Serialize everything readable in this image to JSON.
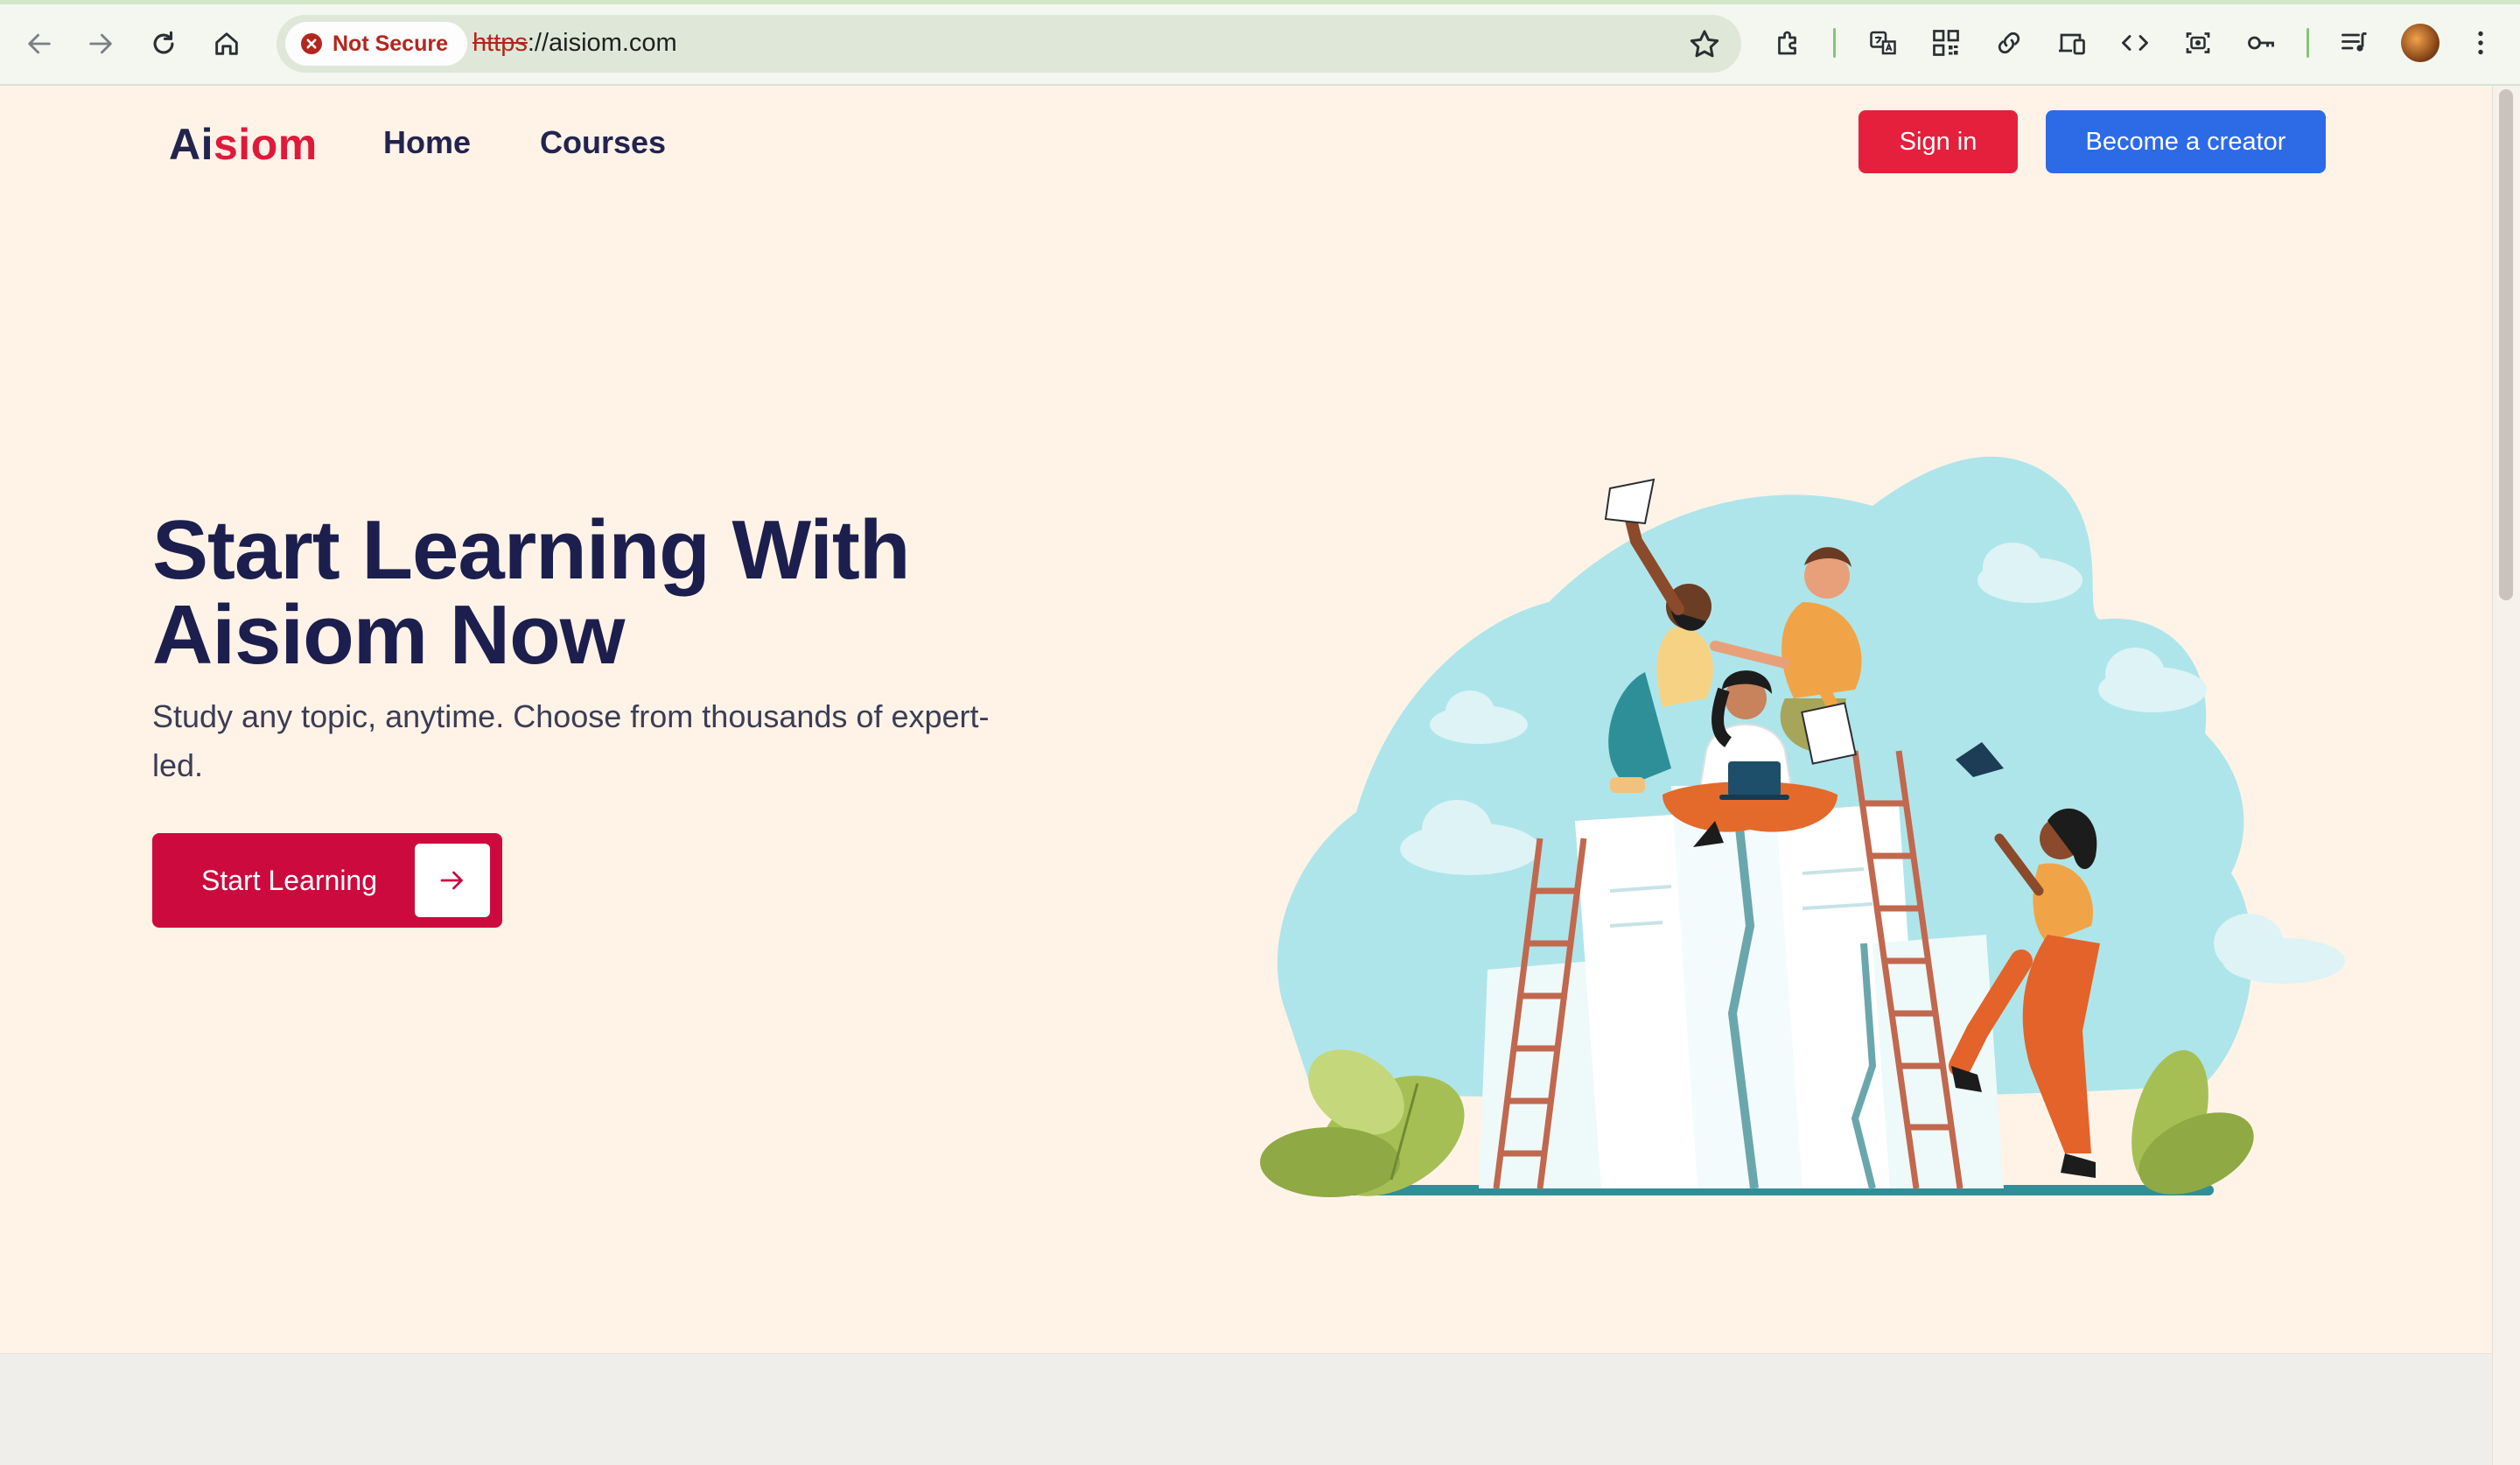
{
  "browser": {
    "security_label": "Not Secure",
    "url_scheme": "https",
    "url_rest": "://aisiom.com",
    "toolbar_icons": [
      "back-icon",
      "forward-icon",
      "reload-icon",
      "home-icon",
      "bookmark-star-icon",
      "extensions-icon",
      "translate-icon",
      "qr-code-icon",
      "link-icon",
      "device-icon",
      "code-icon",
      "screenshot-icon",
      "password-key-icon",
      "media-queue-icon",
      "profile-avatar",
      "menu-icon"
    ]
  },
  "site": {
    "logo_part1": "Ai",
    "logo_part2": "siom",
    "nav": {
      "home": "Home",
      "courses": "Courses"
    },
    "signin_label": "Sign in",
    "creator_label": "Become a creator"
  },
  "hero": {
    "title_line1": "Start Learning With",
    "title_line2": "Aisiom Now",
    "subtitle": "Study any topic, anytime. Choose from thousands of expert-led.",
    "cta_label": "Start Learning"
  },
  "colors": {
    "brand_red": "#e5203c",
    "cta_red": "#cc0a3e",
    "brand_blue": "#2d6be6",
    "navy": "#1c1f4d",
    "page_bg": "#fff3e8"
  }
}
